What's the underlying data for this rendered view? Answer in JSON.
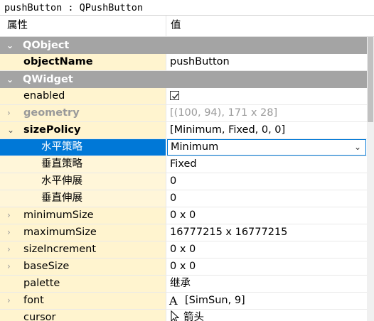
{
  "title": "pushButton : QPushButton",
  "header": {
    "property": "属性",
    "value": "值"
  },
  "rows": [
    {
      "kind": "cat",
      "label": "QObject"
    },
    {
      "kind": "prop",
      "name": "objectName",
      "value": "pushButton",
      "style": "bold",
      "expand": ""
    },
    {
      "kind": "cat",
      "label": "QWidget"
    },
    {
      "kind": "prop",
      "name": "enabled",
      "value": "",
      "checkbox": true,
      "expand": ""
    },
    {
      "kind": "prop",
      "name": "geometry",
      "value": "[(100, 94), 171 x 28]",
      "style": "grey",
      "expand": ">"
    },
    {
      "kind": "prop",
      "name": "sizePolicy",
      "value": "[Minimum, Fixed, 0, 0]",
      "style": "bold",
      "expand": "v"
    },
    {
      "kind": "prop",
      "name": "水平策略",
      "value": "Minimum",
      "sub": true,
      "selected": true,
      "combo": true
    },
    {
      "kind": "prop",
      "name": "垂直策略",
      "value": "Fixed",
      "sub": true
    },
    {
      "kind": "prop",
      "name": "水平伸展",
      "value": "0",
      "sub": true
    },
    {
      "kind": "prop",
      "name": "垂直伸展",
      "value": "0",
      "sub": true
    },
    {
      "kind": "prop",
      "name": "minimumSize",
      "value": "0 x 0",
      "expand": ">"
    },
    {
      "kind": "prop",
      "name": "maximumSize",
      "value": "16777215 x 16777215",
      "expand": ">"
    },
    {
      "kind": "prop",
      "name": "sizeIncrement",
      "value": "0 x 0",
      "expand": ">"
    },
    {
      "kind": "prop",
      "name": "baseSize",
      "value": "0 x 0",
      "expand": ">"
    },
    {
      "kind": "prop",
      "name": "palette",
      "value": "继承",
      "expand": ""
    },
    {
      "kind": "prop",
      "name": "font",
      "value": "[SimSun, 9]",
      "icon": "A",
      "expand": ">"
    },
    {
      "kind": "prop",
      "name": "cursor",
      "value": "箭头",
      "cursoricon": true,
      "expand": ""
    }
  ]
}
